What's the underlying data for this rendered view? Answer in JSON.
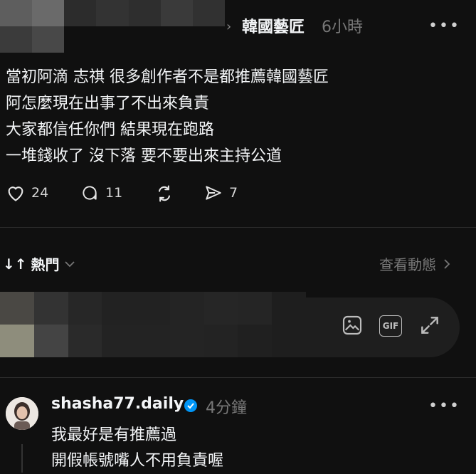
{
  "post": {
    "breadcrumb_arrow": "›",
    "community": "韓國藝匠",
    "time": "6小時",
    "more": "•••",
    "lines": [
      "當初阿滴 志祺 很多創作者不是都推薦韓國藝匠",
      "阿怎麼現在出事了不出來負責",
      "大家都信任你們 結果現在跑路",
      "一堆錢收了 沒下落 要不要出來主持公道"
    ],
    "likes": "24",
    "comments": "11",
    "reposts": "",
    "shares": "7"
  },
  "replies_header": {
    "sort_label": "熱門",
    "view_activity": "查看動態"
  },
  "composer": {
    "gif_label": "GIF"
  },
  "comment": {
    "username": "shasha77.daily",
    "time": "4分鐘",
    "more": "•••",
    "lines": [
      "我最好是有推薦過",
      "開假帳號嘴人不用負責喔"
    ]
  },
  "colors": {
    "background": "#101010",
    "verified": "#0095f6",
    "muted": "#777777"
  }
}
